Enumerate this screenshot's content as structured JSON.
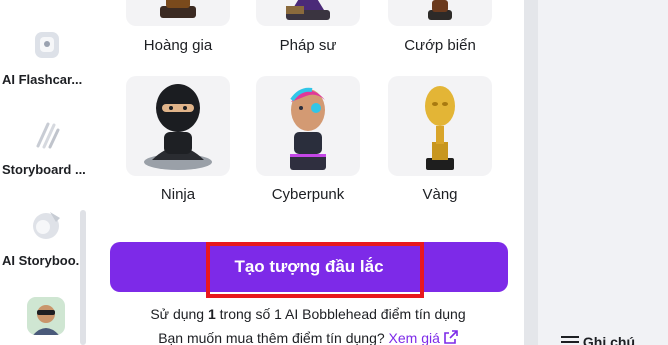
{
  "sidebar": {
    "tools": [
      {
        "label": "AI Flashcar..."
      },
      {
        "label": "Storyboard ..."
      },
      {
        "label": "AI Storyboo..."
      }
    ]
  },
  "styles": {
    "row1": [
      {
        "label": "Hoàng gia"
      },
      {
        "label": "Pháp sư"
      },
      {
        "label": "Cướp biển"
      }
    ],
    "row2": [
      {
        "label": "Ninja"
      },
      {
        "label": "Cyberpunk"
      },
      {
        "label": "Vàng"
      }
    ]
  },
  "action": {
    "create_label": "Tạo tượng đầu lắc"
  },
  "credits": {
    "prefix": "Sử dụng ",
    "count": "1",
    "suffix": " trong số 1 AI Bobblehead điểm tín dụng",
    "buy_question": "Bạn muốn mua thêm điểm tín dụng?",
    "buy_link": "Xem giá"
  },
  "right": {
    "notes_label": "Ghi chú"
  },
  "colors": {
    "accent": "#7d2ae8",
    "highlight_frame": "#e8181e"
  }
}
